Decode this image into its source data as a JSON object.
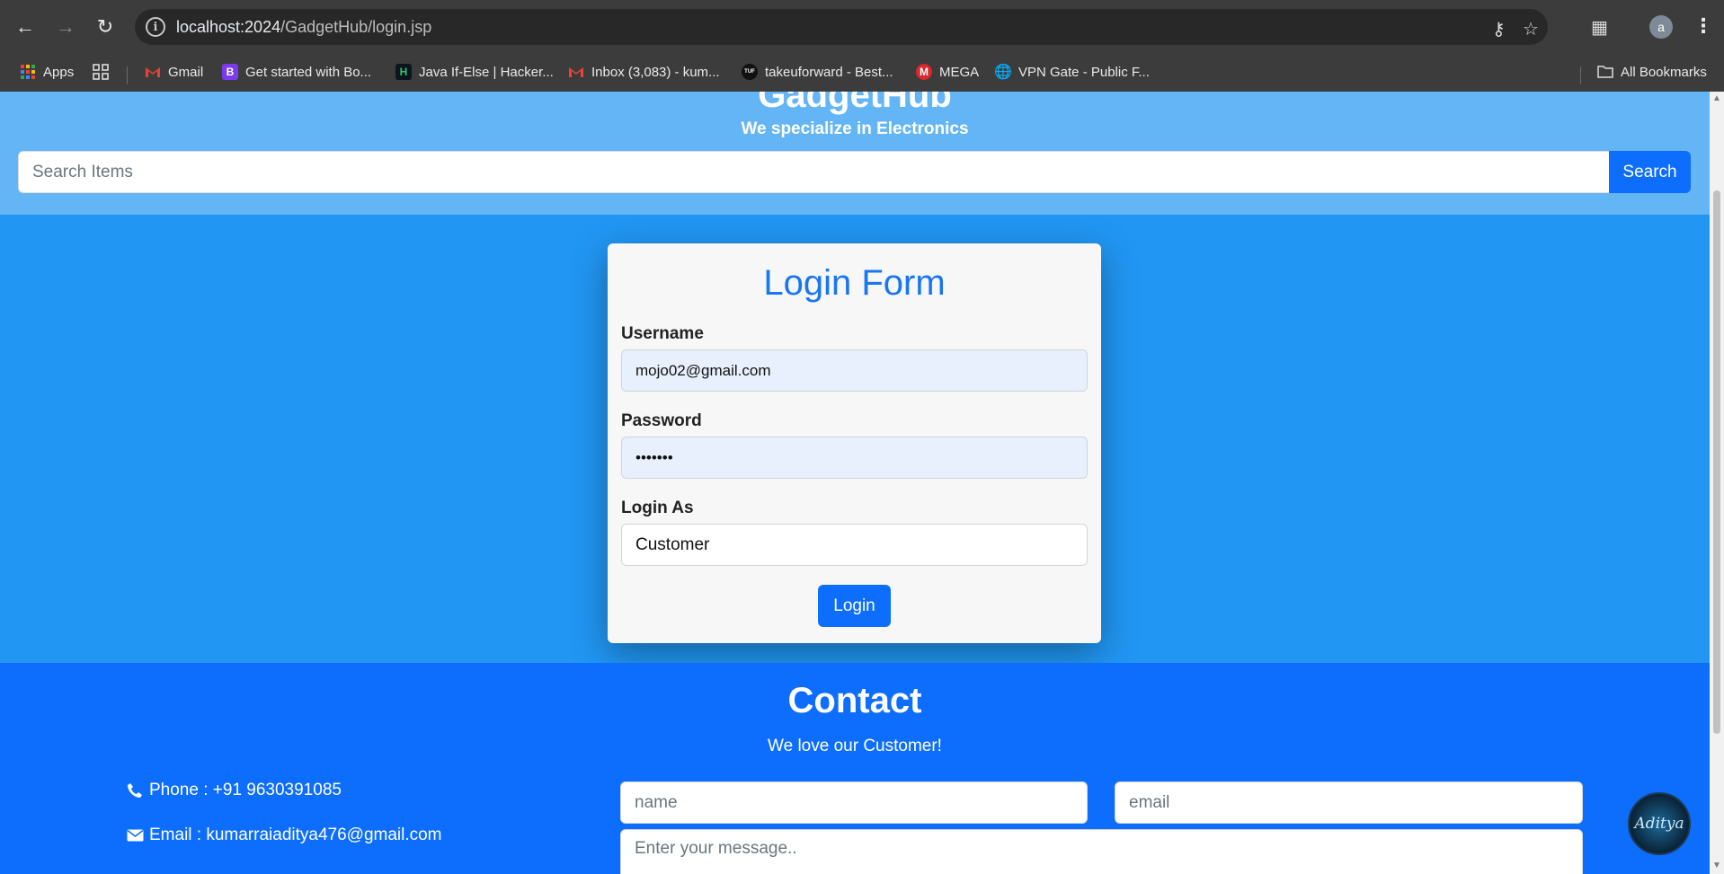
{
  "browser": {
    "url_host": "localhost:2024",
    "url_path": "/GadgetHub/login.jsp",
    "bookmarks": [
      {
        "label": "Apps"
      },
      {
        "label": "Gmail"
      },
      {
        "label": "Get started with Bo..."
      },
      {
        "label": "Java If-Else | Hacker..."
      },
      {
        "label": "Inbox (3,083) - kum..."
      },
      {
        "label": "takeuforward - Best..."
      },
      {
        "label": "MEGA"
      },
      {
        "label": "VPN Gate - Public F..."
      }
    ],
    "all_bookmarks_label": "All Bookmarks",
    "profile_initial": "a",
    "bookmark_icon_glyphs": {
      "bootstrap": "B",
      "hackerrank": "H",
      "tuf": "TUF"
    }
  },
  "header": {
    "brand": "GadgetHub",
    "tagline": "We specialize in Electronics",
    "search_placeholder": "Search Items",
    "search_label": "Search"
  },
  "login": {
    "title": "Login Form",
    "username_label": "Username",
    "username_value": "mojo02@gmail.com",
    "password_label": "Password",
    "password_value": "•••••••",
    "login_as_label": "Login As",
    "login_as_value": "Customer",
    "submit_label": "Login"
  },
  "contact": {
    "title": "Contact",
    "subtitle": "We love our Customer!",
    "phone": "Phone : +91 9630391085",
    "email": "Email : kumarraiaditya476@gmail.com",
    "name_placeholder": "name",
    "email_placeholder": "email",
    "message_placeholder": "Enter your message..",
    "avatar_text": "Aditya"
  },
  "colors": {
    "hero_bg": "#64b5f6",
    "main_bg": "#2196f3",
    "contact_bg": "#0d6efd",
    "accent": "#0d6efd",
    "card_title": "#1976f0"
  }
}
